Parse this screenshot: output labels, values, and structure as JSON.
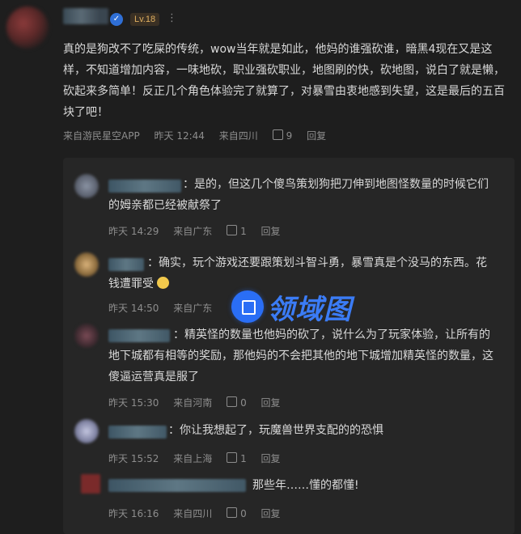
{
  "top_comment": {
    "level_badge": "Lv.18",
    "more": "⋮",
    "lines": [
      "真的是狗改不了吃屎的传统，wow当年就是如此，他妈的谁强砍谁，暗黑4现在又是这",
      "样，不知道增加内容，一味地砍，职业强砍职业，地图刷的快，砍地图，说白了就是懒，",
      "砍起来多简单！反正几个角色体验完了就算了，对暴雪由衷地感到失望，这是最后的五百",
      "块了吧！"
    ],
    "source": "来自游民星空APP",
    "time": "昨天 12:44",
    "location": "来自四川",
    "likes": "9",
    "reply_label": "回复"
  },
  "replies": [
    {
      "lines": [
        "：是的，但这几个傻鸟策划狗把刀伸到地图怪数量的时候它们",
        "的姆亲都已经被献祭了"
      ],
      "time": "昨天 14:29",
      "location": "来自广东",
      "likes": "1",
      "reply_label": "回复"
    },
    {
      "lines": [
        "：确实，玩个游戏还要跟策划斗智斗勇，暴雪真是个没马的东西。花",
        "钱遭罪受"
      ],
      "time": "昨天 14:50",
      "location": "来自广东",
      "likes": "",
      "reply_label": ""
    },
    {
      "lines": [
        "：精英怪的数量也他妈的砍了，说什么为了玩家体验，让所有的",
        "地下城都有相等的奖励，那他妈的不会把其他的地下城增加精英怪的数量，这",
        "傻逼运营真是服了"
      ],
      "time": "昨天 15:30",
      "location": "来自河南",
      "likes": "0",
      "reply_label": "回复"
    },
    {
      "lines": [
        "：你让我想起了，玩魔兽世界支配的的恐惧"
      ],
      "time": "昨天 15:52",
      "location": "来自上海",
      "likes": "1",
      "reply_label": "回复"
    },
    {
      "lines": [
        "那些年……懂的都懂!"
      ],
      "time": "昨天 16:16",
      "location": "来自四川",
      "likes": "0",
      "reply_label": "回复"
    }
  ],
  "watermark": {
    "text": "领域图"
  },
  "colors": {
    "background": "#1e1e1e",
    "reply_box": "#262626",
    "verified": "#2f6fd6",
    "level": "#e0b060",
    "watermark": "#3b7cf6"
  }
}
